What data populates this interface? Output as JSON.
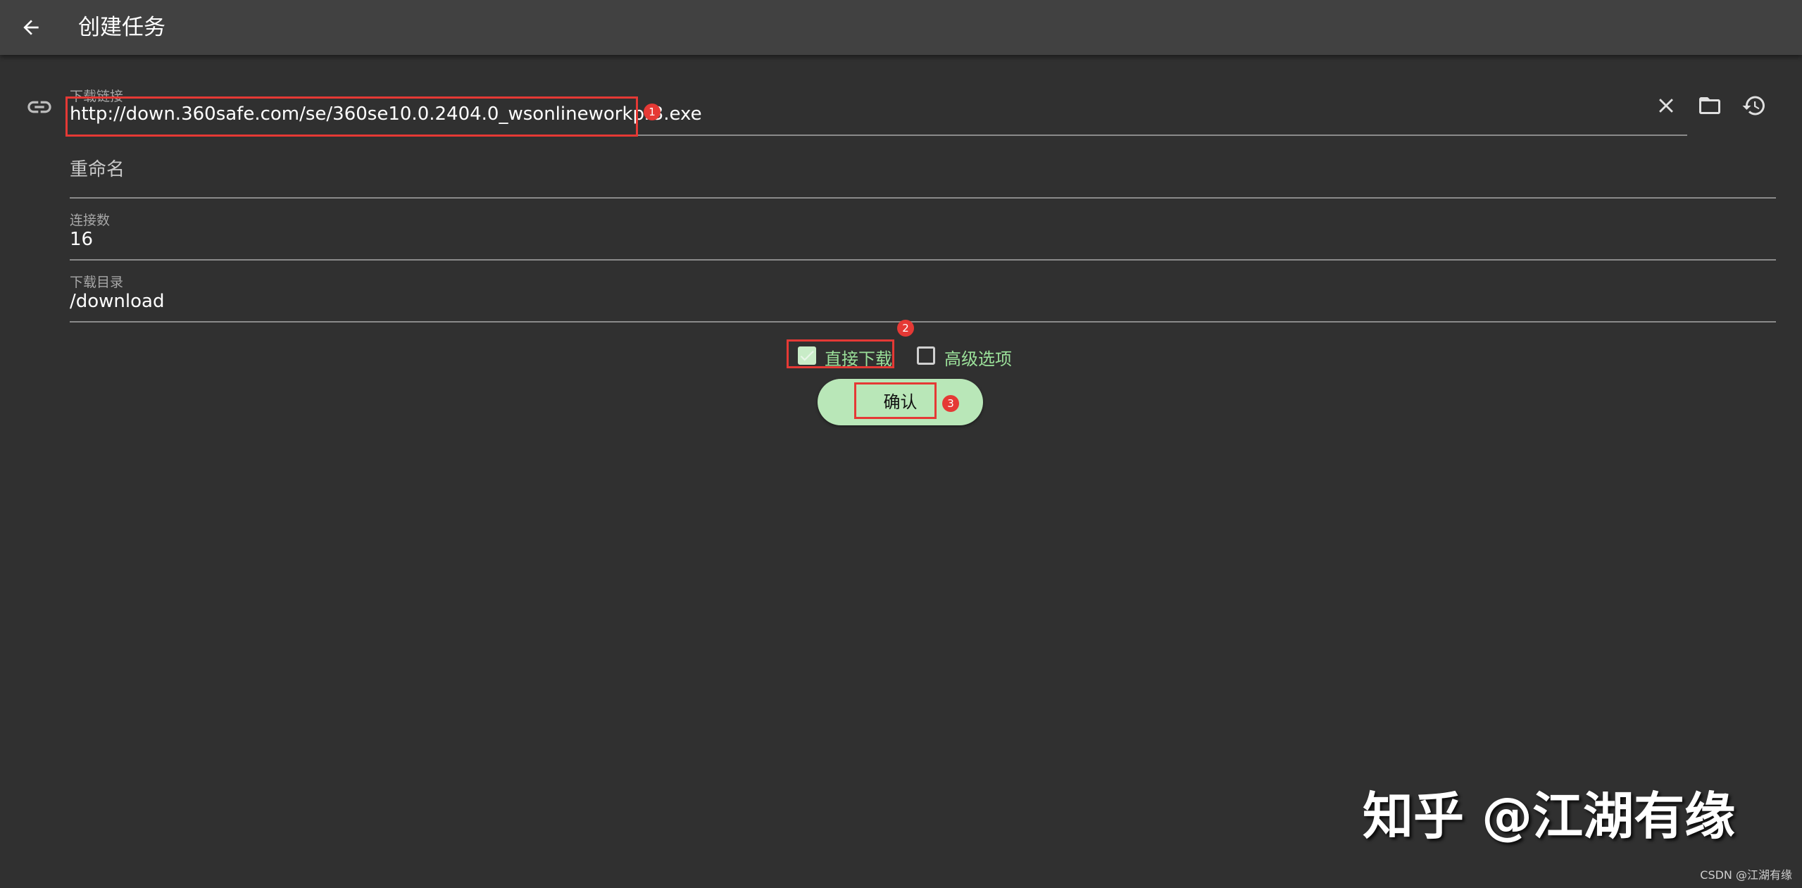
{
  "appbar": {
    "title": "创建任务",
    "back_icon": "arrow-left-icon"
  },
  "form": {
    "url_field": {
      "label": "下载链接",
      "value": "http://down.360safe.com/se/360se10.0.2404.0_wsonlineworkpr3.exe",
      "icon": "link-icon",
      "actions": [
        "clear-icon",
        "folder-icon",
        "history-icon"
      ]
    },
    "rename_field": {
      "placeholder": "重命名",
      "value": ""
    },
    "connections_field": {
      "label": "连接数",
      "value": "16"
    },
    "directory_field": {
      "label": "下载目录",
      "value": "/download"
    },
    "options": {
      "direct_download": {
        "label": "直接下载",
        "checked": true
      },
      "advanced_options": {
        "label": "高级选项",
        "checked": false
      }
    },
    "confirm_button": {
      "label": "确认"
    }
  },
  "annotations": {
    "badge_1": "1",
    "badge_2": "2",
    "badge_3": "3"
  },
  "watermarks": {
    "zhihu": "知乎 @江湖有缘",
    "csdn": "CSDN @江湖有缘"
  },
  "colors": {
    "background": "#303030",
    "appbar": "#414141",
    "accent_green": "#9be19a",
    "button_green": "#b9e7b8",
    "annotation_red": "#e53935"
  }
}
